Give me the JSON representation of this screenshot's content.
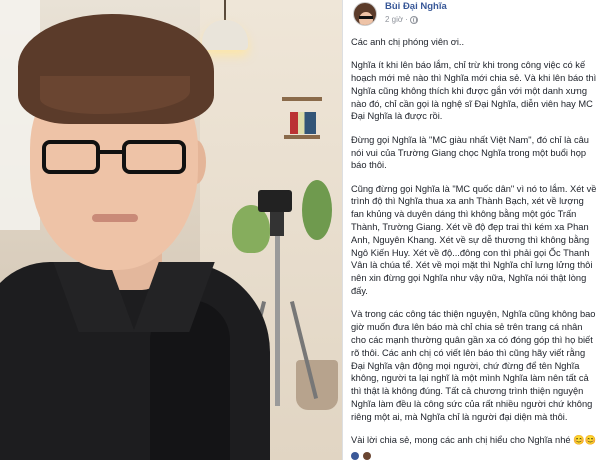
{
  "post": {
    "author": "Bùi Đại Nghĩa",
    "time": "2 giờ",
    "time_separator": "·",
    "paragraphs": [
      "Các anh chị phóng viên ơi..",
      "Nghĩa ít khi lên báo lắm, chỉ trừ khi trong công việc có kế hoạch mới mẻ nào thì Nghĩa mới chia sẻ. Và khi lên báo thì Nghĩa cũng không thích khi được gắn với một danh xưng nào đó, chỉ cần gọi là nghệ sĩ Đại Nghĩa, diễn viên hay MC Đại Nghĩa là được rồi.",
      "Đừng gọi Nghĩa là \"MC giàu nhất Việt Nam\", đó chỉ là câu nói vui của Trường Giang chọc Nghĩa trong một buổi họp báo thôi.",
      "Cũng đừng gọi Nghĩa là \"MC quốc dân\" vì nó to lắm. Xét về trình độ thì Nghĩa thua xa anh Thành Bạch, xét về lượng fan khủng và duyên dáng thì không bằng một góc Trấn Thành, Trường Giang. Xét về độ đẹp trai thì kém xa Phan Anh, Nguyên Khang. Xét về sự dễ thương thì không bằng Ngô Kiến Huy. Xét về độ...đông con thì phải gọi Ốc Thanh Vân là chúa tể. Xét về mọi mặt thì Nghĩa chỉ lưng lửng thôi nên xin đừng gọi Nghĩa như vậy nữa, Nghĩa nói thật lòng đấy.",
      "Và trong các công tác thiện nguyện, Nghĩa cũng không bao giờ muốn đưa lên báo mà chỉ chia sẻ trên trang cá nhân cho các mạnh thường quân gần xa có đóng góp thì họ biết rõ thôi. Các anh chị có viết lên báo thì cũng hãy viết rằng Đại Nghĩa vận động mọi người, chứ đừng để tên Nghĩa không, người ta lại nghĩ là một mình Nghĩa làm nên tất cả thì thật là không đúng. Tất cả chương trình thiện nguyện Nghĩa làm đều là công sức của rất nhiều người chứ không riêng một ai, mà Nghĩa chỉ là người đại diện mà thôi.",
      "Vài lời chia sẻ, mong các anh chị hiểu cho Nghĩa nhé 😊😊"
    ]
  },
  "photo": {
    "subject": "selfie-photo"
  }
}
